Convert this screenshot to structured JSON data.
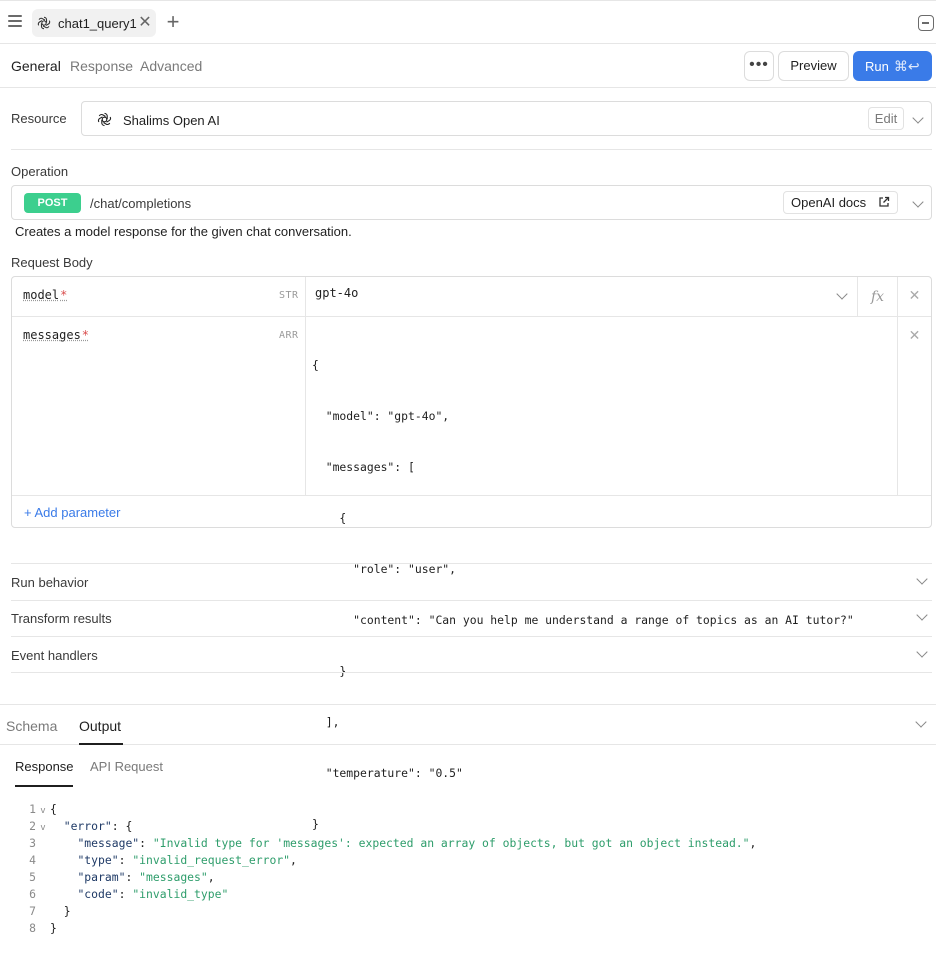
{
  "tabbar": {
    "tab_label": "chat1_query1",
    "close_glyph": "✕",
    "add_glyph": "+"
  },
  "subnav": {
    "tabs": [
      "General",
      "Response",
      "Advanced"
    ],
    "more_label": "•••",
    "preview_label": "Preview",
    "run_label": "Run",
    "run_shortcut": "⌘↩"
  },
  "resource": {
    "label": "Resource",
    "name": "Shalims Open AI",
    "edit_label": "Edit"
  },
  "operation": {
    "label": "Operation",
    "method": "POST",
    "path": "/chat/completions",
    "docs_label": "OpenAI docs",
    "description": "Creates a model response for the given chat conversation."
  },
  "request_body": {
    "label": "Request Body",
    "params": [
      {
        "name": "model",
        "required_mark": "*",
        "type": "STR",
        "value": "gpt-4o"
      },
      {
        "name": "messages",
        "required_mark": "*",
        "type": "ARR",
        "value_lines": [
          "{",
          "  \"model\": \"gpt-4o\",",
          "  \"messages\": [",
          "    {",
          "      \"role\": \"user\",",
          "      \"content\": \"Can you help me understand a range of topics as an AI tutor?\"",
          "    }",
          "  ],",
          "  \"temperature\": \"0.5\"",
          "}"
        ]
      }
    ],
    "fx_label": "fx",
    "remove_glyph": "✕",
    "add_param_label": "+ Add parameter"
  },
  "sections": [
    "Run behavior",
    "Transform results",
    "Event handlers"
  ],
  "bottom_panel": {
    "tabs": [
      "Schema",
      "Output"
    ],
    "response_tabs": [
      "Response",
      "API Request"
    ],
    "json_lines": [
      {
        "n": "1",
        "fold": "v",
        "indent": "",
        "parts": [
          [
            "punc",
            "{"
          ]
        ]
      },
      {
        "n": "2",
        "fold": "v",
        "indent": "  ",
        "parts": [
          [
            "key",
            "\"error\""
          ],
          [
            "punc",
            ": {"
          ]
        ]
      },
      {
        "n": "3",
        "fold": "",
        "indent": "    ",
        "parts": [
          [
            "key",
            "\"message\""
          ],
          [
            "punc",
            ": "
          ],
          [
            "str",
            "\"Invalid type for 'messages': expected an array of objects, but got an object instead.\""
          ],
          [
            "punc",
            ","
          ]
        ]
      },
      {
        "n": "4",
        "fold": "",
        "indent": "    ",
        "parts": [
          [
            "key",
            "\"type\""
          ],
          [
            "punc",
            ": "
          ],
          [
            "str",
            "\"invalid_request_error\""
          ],
          [
            "punc",
            ","
          ]
        ]
      },
      {
        "n": "5",
        "fold": "",
        "indent": "    ",
        "parts": [
          [
            "key",
            "\"param\""
          ],
          [
            "punc",
            ": "
          ],
          [
            "str",
            "\"messages\""
          ],
          [
            "punc",
            ","
          ]
        ]
      },
      {
        "n": "6",
        "fold": "",
        "indent": "    ",
        "parts": [
          [
            "key",
            "\"code\""
          ],
          [
            "punc",
            ": "
          ],
          [
            "str",
            "\"invalid_type\""
          ]
        ]
      },
      {
        "n": "7",
        "fold": "",
        "indent": "  ",
        "parts": [
          [
            "punc",
            "}"
          ]
        ]
      },
      {
        "n": "8",
        "fold": "",
        "indent": "",
        "parts": [
          [
            "punc",
            "}"
          ]
        ]
      }
    ]
  },
  "colors": {
    "run_button": "#3a7be8",
    "post_badge": "#3ccf8e",
    "json_string": "#2e9d6b",
    "required_mark": "#d94b4b"
  },
  "icons": [
    "menu-icon",
    "openai-logo-icon",
    "close-icon",
    "plus-icon",
    "collapse-panel-icon",
    "more-icon",
    "chevron-down-icon",
    "external-link-icon",
    "function-icon"
  ]
}
